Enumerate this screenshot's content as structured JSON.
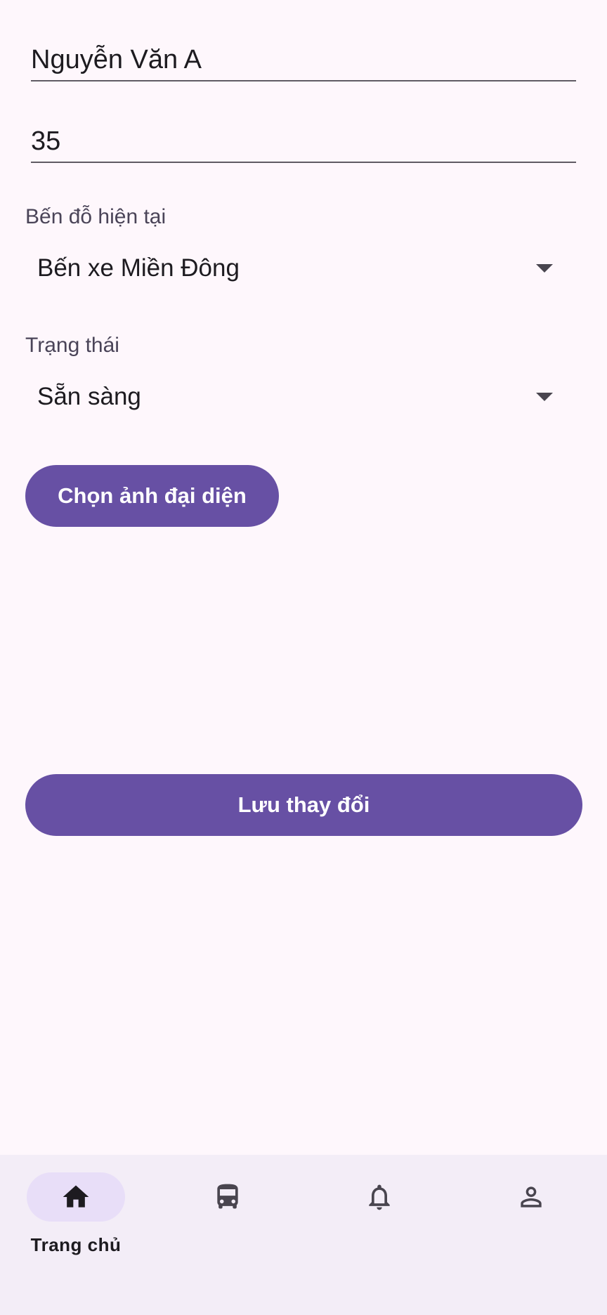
{
  "form": {
    "name_value": "Nguyễn Văn A",
    "age_value": "35",
    "current_stop": {
      "label": "Bến đỗ hiện tại",
      "selected": "Bến xe Miền Đông"
    },
    "status": {
      "label": "Trạng thái",
      "selected": "Sẵn sàng"
    },
    "choose_avatar_label": "Chọn ảnh đại diện",
    "save_label": "Lưu thay đổi"
  },
  "bottom_nav": {
    "items": [
      {
        "label": "Trang chủ",
        "icon": "home-icon",
        "active": true
      },
      {
        "label": "",
        "icon": "bus-icon",
        "active": false
      },
      {
        "label": "",
        "icon": "bell-icon",
        "active": false
      },
      {
        "label": "",
        "icon": "person-icon",
        "active": false
      }
    ]
  },
  "colors": {
    "primary": "#6750a4",
    "background": "#fef7fc",
    "nav_background": "#f3edf7",
    "active_indicator": "#e8def8"
  }
}
